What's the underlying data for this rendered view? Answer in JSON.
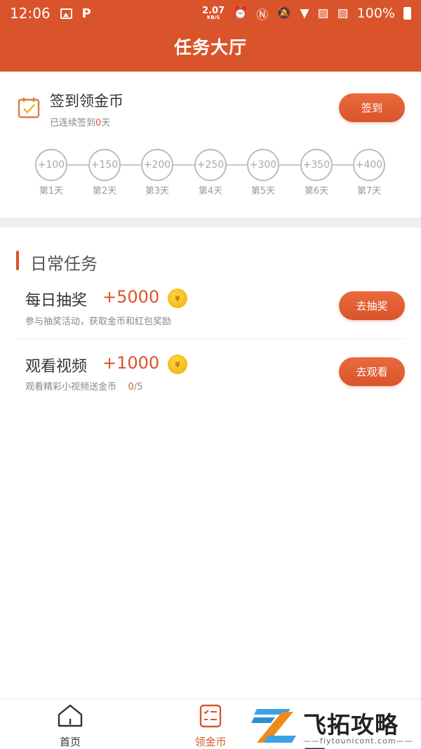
{
  "status_bar": {
    "time": "12:06",
    "net_speed": "2.07",
    "net_unit": "KB/S",
    "battery": "100%"
  },
  "header": {
    "title": "任务大厅"
  },
  "signin": {
    "title": "签到领金币",
    "streak_prefix": "已连续签到",
    "streak_days": "0",
    "streak_suffix": "天",
    "button": "签到",
    "days": [
      {
        "reward": "+100",
        "label": "第1天"
      },
      {
        "reward": "+150",
        "label": "第2天"
      },
      {
        "reward": "+200",
        "label": "第3天"
      },
      {
        "reward": "+250",
        "label": "第4天"
      },
      {
        "reward": "+300",
        "label": "第5天"
      },
      {
        "reward": "+350",
        "label": "第6天"
      },
      {
        "reward": "+400",
        "label": "第7天"
      }
    ]
  },
  "daily": {
    "title": "日常任务",
    "tasks": [
      {
        "name": "每日抽奖",
        "reward": "+5000",
        "coin": "¥",
        "desc": "参与抽奖活动，获取金币和红包奖励",
        "button": "去抽奖"
      },
      {
        "name": "观看视频",
        "reward": "+1000",
        "coin": "¥",
        "desc": "观看精彩小视频送金币",
        "progress_done": "0",
        "progress_total": "/5",
        "button": "去观看"
      }
    ]
  },
  "bottom_nav": {
    "items": [
      {
        "label": "首页",
        "icon": "home-icon"
      },
      {
        "label": "领金币",
        "icon": "task-list-icon"
      }
    ]
  },
  "watermark": {
    "text": "飞拓攻略网",
    "sub": "——fiytounicont.com——"
  },
  "colors": {
    "accent": "#d9542b",
    "coin": "#f5b914"
  }
}
